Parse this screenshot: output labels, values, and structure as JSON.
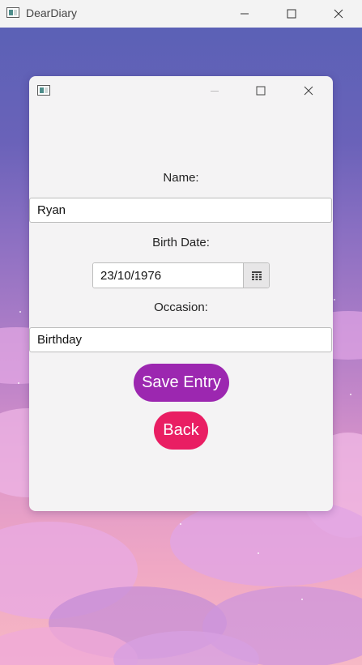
{
  "app": {
    "title": "DearDiary"
  },
  "form": {
    "name_label": "Name:",
    "name_value": "Ryan",
    "birth_label": "Birth Date:",
    "birth_value": "23/10/1976",
    "occasion_label": "Occasion:",
    "occasion_value": "Birthday",
    "save_label": "Save Entry",
    "back_label": "Back"
  },
  "colors": {
    "save_button": "#9c27b0",
    "back_button": "#e91e63",
    "dialog_bg": "#f4f3f4"
  },
  "icons": {
    "app": "app-window-icon",
    "minimize": "minimize-icon",
    "maximize": "maximize-icon",
    "close": "close-icon",
    "calendar": "calendar-icon"
  }
}
